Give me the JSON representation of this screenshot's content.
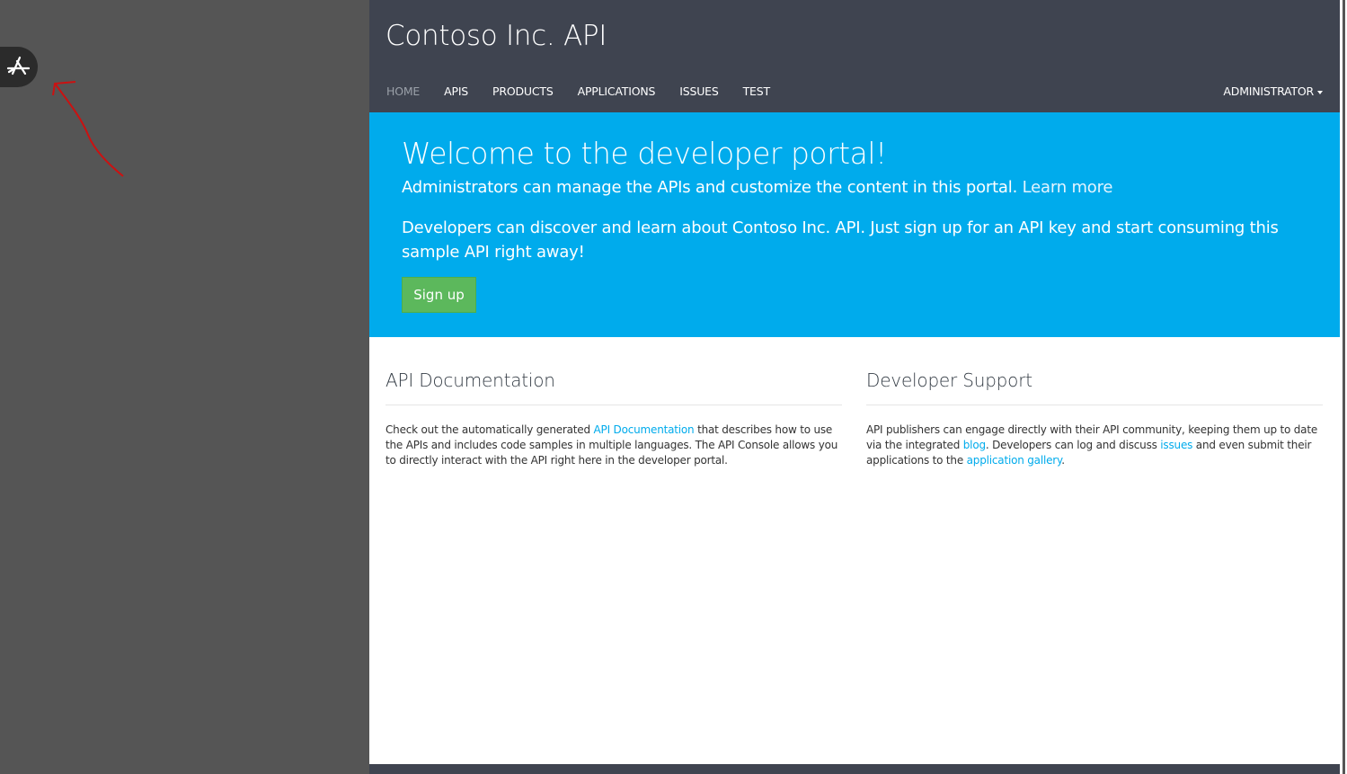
{
  "header": {
    "brand": "Contoso Inc. API",
    "nav": [
      "HOME",
      "APIS",
      "PRODUCTS",
      "APPLICATIONS",
      "ISSUES",
      "TEST"
    ],
    "user_menu": "ADMINISTRATOR"
  },
  "hero": {
    "title": "Welcome to the developer portal!",
    "admin_text": "Administrators can manage the APIs and customize the content in this portal.",
    "learn_more": "Learn more",
    "dev_text": "Developers can discover and learn about Contoso Inc. API. Just sign up for an API key and start consuming this sample API right away!",
    "signup_label": "Sign up"
  },
  "api_docs": {
    "title": "API Documentation",
    "text_before": "Check out the automatically generated ",
    "link": "API Documentation",
    "text_after": " that describes how to use the APIs and includes code samples in multiple languages. The API Console allows you to directly interact with the API right here in the developer portal."
  },
  "dev_support": {
    "title": "Developer Support",
    "t1": "API publishers can engage directly with their API community, keeping them up to date via the integrated ",
    "link_blog": "blog",
    "t2": ". Developers can log and discuss ",
    "link_issues": "issues",
    "t3": " and even submit their applications to the ",
    "link_gallery": "application gallery",
    "t4": "."
  },
  "icons": {
    "designer_toggle": "app-designer-icon",
    "annotation": "red-arrow-icon"
  },
  "colors": {
    "header_bg": "#3f4450",
    "hero_bg": "#00abec",
    "signup_bg": "#5cb85c",
    "link": "#00abec",
    "workspace_bg": "#555555"
  }
}
